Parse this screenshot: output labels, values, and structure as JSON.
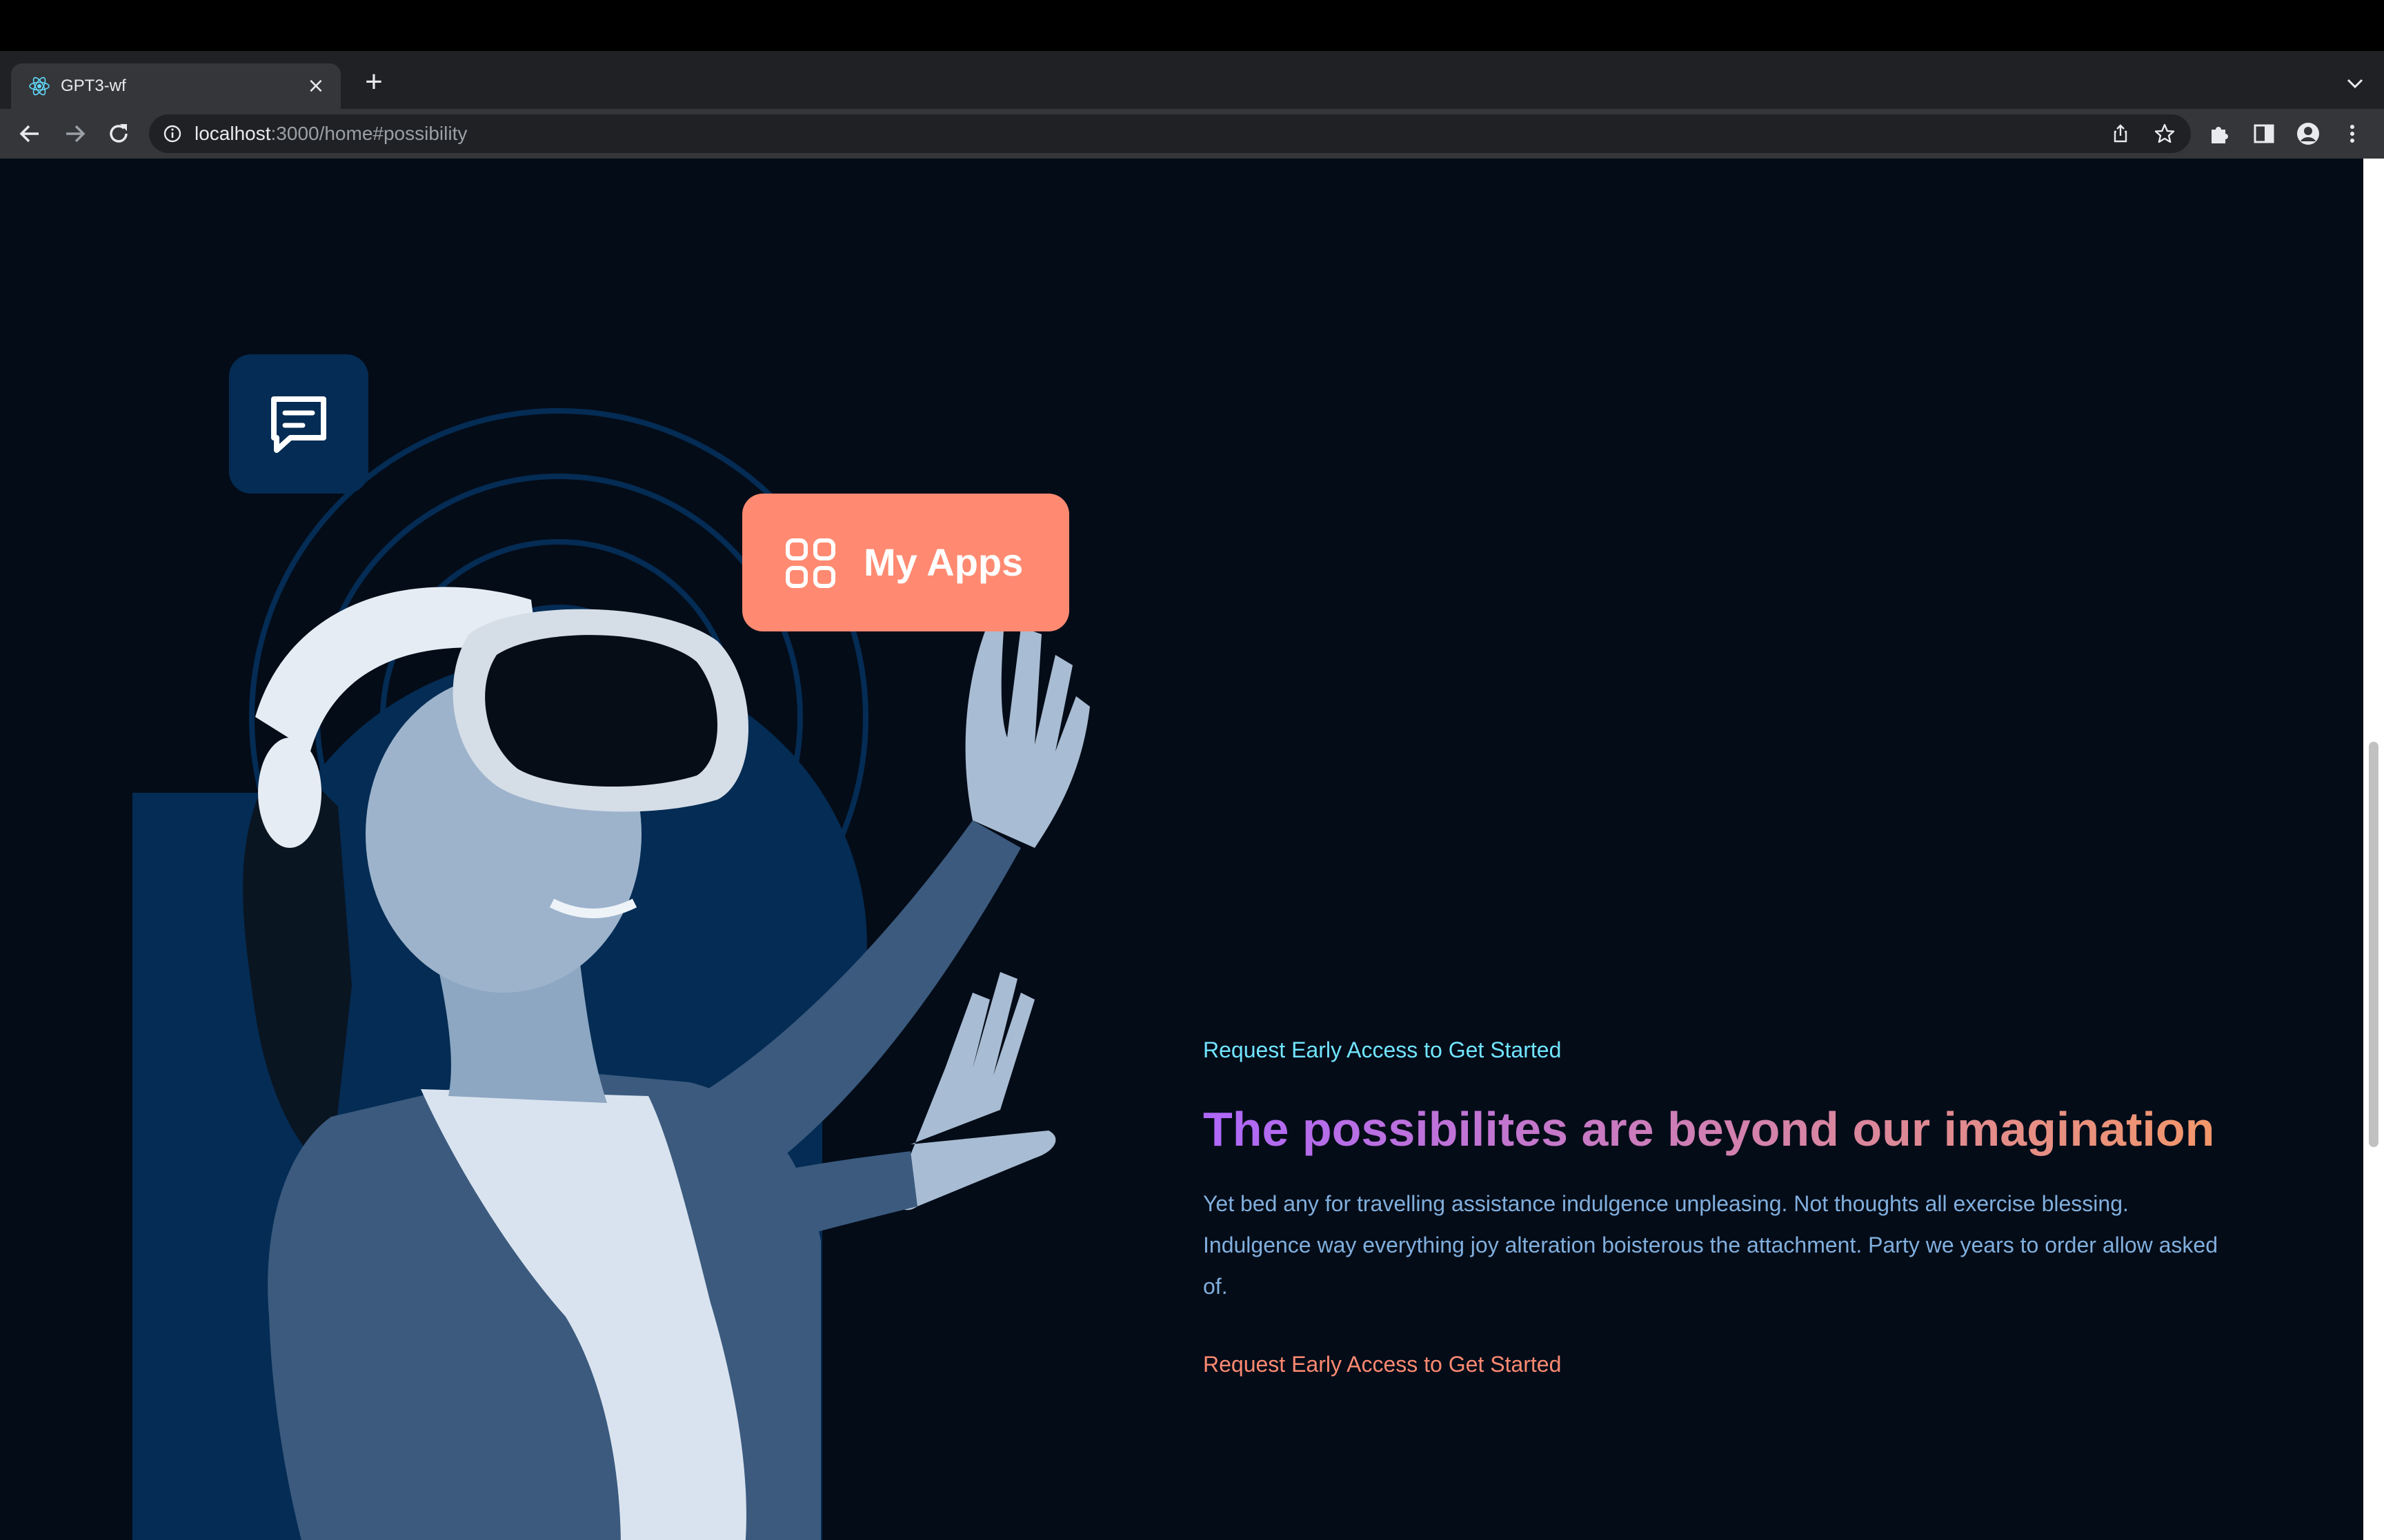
{
  "browser": {
    "tab_title": "GPT3-wf",
    "tab_close": "×",
    "new_tab": "+",
    "url_host": "localhost",
    "url_path": ":3000/home#possibility",
    "icons": [
      "react-favicon-icon",
      "back-icon",
      "forward-icon",
      "reload-icon",
      "info-icon",
      "share-icon",
      "bookmark-star-icon",
      "extensions-icon",
      "side-panel-icon",
      "profile-icon",
      "menu-icon",
      "tab-search-icon"
    ]
  },
  "hero": {
    "apps_label": "My Apps"
  },
  "possibility": {
    "eyebrow": "Request Early Access to Get Started",
    "headline": "The possibilites are beyond our imagination",
    "body": "Yet bed any for travelling assistance indulgence unpleasing. Not thoughts all exercise blessing. Indulgence way everything joy alteration boisterous the attachment. Party we years to order allow asked of.",
    "cta": "Request Early Access to Get Started"
  },
  "colors": {
    "page_bg": "#040c18",
    "eyebrow": "#71e5ff",
    "gradient_start": "#ae67fa",
    "gradient_end": "#f49867",
    "body_text": "#81afdd",
    "cta": "#ff8a71",
    "apps_card": "#ff8a71",
    "chat_card": "#042c54"
  }
}
